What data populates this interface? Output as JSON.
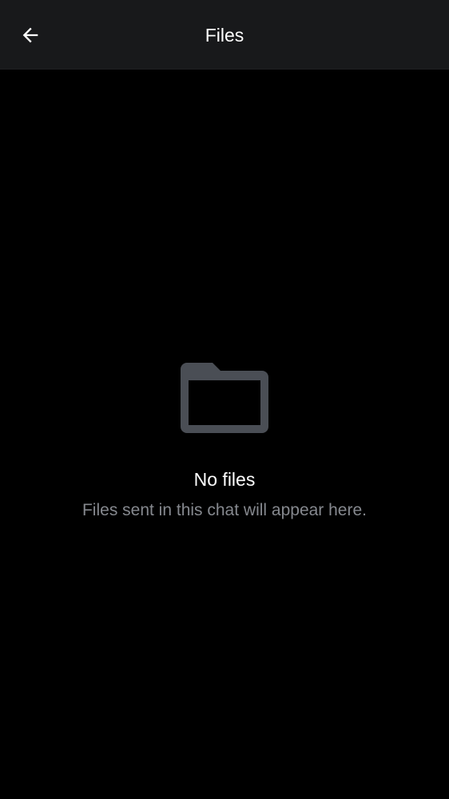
{
  "header": {
    "title": "Files",
    "back_icon": "arrow-left-icon"
  },
  "empty_state": {
    "icon": "folder-icon",
    "title": "No files",
    "subtitle": "Files sent in this chat will appear here."
  },
  "colors": {
    "background": "#000000",
    "header_background": "#18191b",
    "title_text": "#ffffff",
    "subtitle_text": "#85888e",
    "folder_icon": "#4a4e55"
  }
}
